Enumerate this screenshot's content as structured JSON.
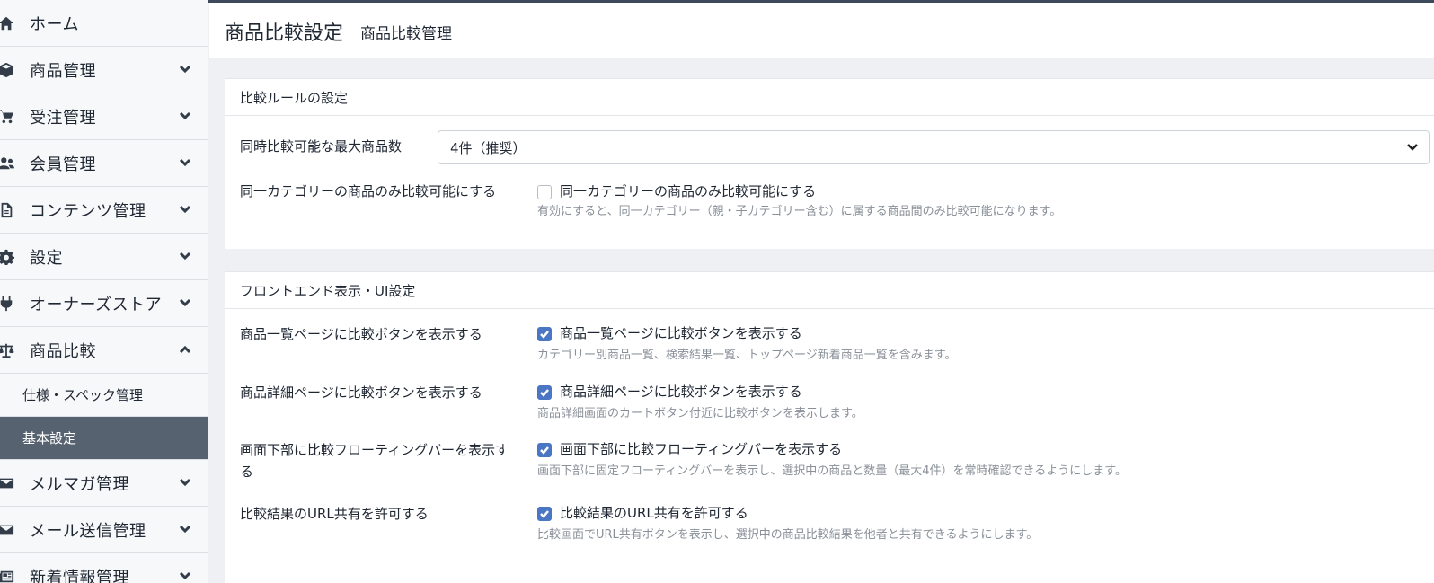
{
  "sidebar": {
    "items": [
      {
        "label": "ホーム",
        "icon": "home-icon",
        "chevron": ""
      },
      {
        "label": "商品管理",
        "icon": "cube-icon",
        "chevron": "down"
      },
      {
        "label": "受注管理",
        "icon": "cart-icon",
        "chevron": "down"
      },
      {
        "label": "会員管理",
        "icon": "users-icon",
        "chevron": "down"
      },
      {
        "label": "コンテンツ管理",
        "icon": "file-icon",
        "chevron": "down"
      },
      {
        "label": "設定",
        "icon": "gear-icon",
        "chevron": "down"
      },
      {
        "label": "オーナーズストア",
        "icon": "plug-icon",
        "chevron": "down"
      },
      {
        "label": "商品比較",
        "icon": "scale-icon",
        "chevron": "up"
      }
    ],
    "subitems": [
      {
        "label": "仕様・スペック管理",
        "active": false
      },
      {
        "label": "基本設定",
        "active": true
      }
    ],
    "items_after": [
      {
        "label": "メルマガ管理",
        "icon": "envelope-icon",
        "chevron": "down"
      },
      {
        "label": "メール送信管理",
        "icon": "envelope-icon",
        "chevron": "down"
      },
      {
        "label": "新着情報管理",
        "icon": "newspaper-icon",
        "chevron": "down"
      }
    ]
  },
  "header": {
    "title": "商品比較設定",
    "subtitle": "商品比較管理"
  },
  "card1": {
    "title": "比較ルールの設定",
    "max_label": "同時比較可能な最大商品数",
    "max_value": "4件（推奨）",
    "same_cat_label": "同一カテゴリーの商品のみ比較可能にする",
    "same_cat_check": "同一カテゴリーの商品のみ比較可能にする",
    "same_cat_checked": false,
    "same_cat_help": "有効にすると、同一カテゴリー（親・子カテゴリー含む）に属する商品間のみ比較可能になります。"
  },
  "card2": {
    "title": "フロントエンド表示・UI設定",
    "rows": [
      {
        "label": "商品一覧ページに比較ボタンを表示する",
        "check": "商品一覧ページに比較ボタンを表示する",
        "checked": true,
        "help": "カテゴリー別商品一覧、検索結果一覧、トップページ新着商品一覧を含みます。"
      },
      {
        "label": "商品詳細ページに比較ボタンを表示する",
        "check": "商品詳細ページに比較ボタンを表示する",
        "checked": true,
        "help": "商品詳細画面のカートボタン付近に比較ボタンを表示します。"
      },
      {
        "label": "画面下部に比較フローティングバーを表示する",
        "check": "画面下部に比較フローティングバーを表示する",
        "checked": true,
        "help": "画面下部に固定フローティングバーを表示し、選択中の商品と数量（最大4件）を常時確認できるようにします。"
      },
      {
        "label": "比較結果のURL共有を許可する",
        "check": "比較結果のURL共有を許可する",
        "checked": true,
        "help": "比較画面でURL共有ボタンを表示し、選択中の商品比較結果を他者と共有できるようにします。"
      }
    ]
  },
  "colors": {
    "accent": "#4a76c4",
    "sidebar_active": "#56626f",
    "topline": "#3d4a5c"
  }
}
